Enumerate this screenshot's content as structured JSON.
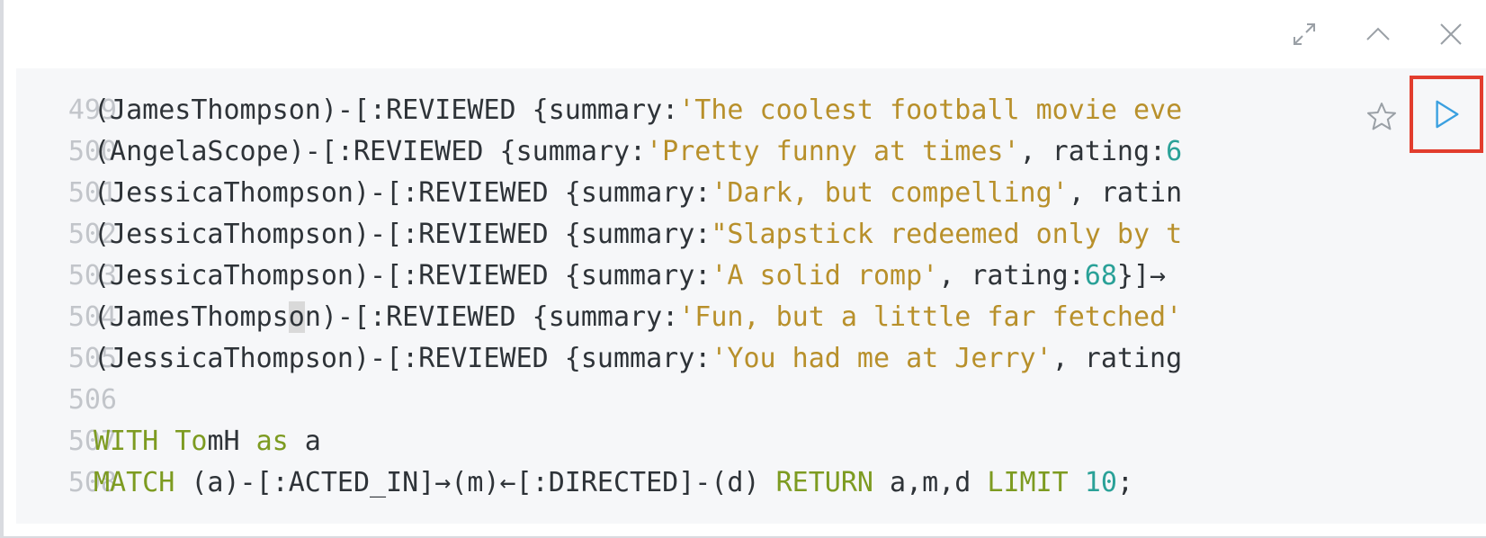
{
  "toolbar": {
    "fullscreen_icon": "expand-icon",
    "collapse_icon": "chevron-up-icon",
    "close_icon": "close-icon"
  },
  "editor": {
    "line_numbers": [
      "499",
      "500",
      "501",
      "502",
      "503",
      "504",
      "505",
      "506",
      "507",
      "508"
    ],
    "lines": [
      [
        {
          "t": "(JamesThompson)-[:REVIEWED {summary:",
          "c": ""
        },
        {
          "t": "'The coolest football movie eve",
          "c": "str"
        }
      ],
      [
        {
          "t": "(AngelaScope)-[:REVIEWED {summary:",
          "c": ""
        },
        {
          "t": "'Pretty funny at times'",
          "c": "str"
        },
        {
          "t": ", rating:",
          "c": ""
        },
        {
          "t": "6",
          "c": "num"
        }
      ],
      [
        {
          "t": "(JessicaThompson)-[:REVIEWED {summary:",
          "c": ""
        },
        {
          "t": "'Dark, but compelling'",
          "c": "str"
        },
        {
          "t": ", ratin",
          "c": ""
        }
      ],
      [
        {
          "t": "(JessicaThompson)-[:REVIEWED {summary:",
          "c": ""
        },
        {
          "t": "\"Slapstick redeemed only by t",
          "c": "str"
        }
      ],
      [
        {
          "t": "(JessicaThompson)-[:REVIEWED {summary:",
          "c": ""
        },
        {
          "t": "'A solid romp'",
          "c": "str"
        },
        {
          "t": ", rating:",
          "c": ""
        },
        {
          "t": "68",
          "c": "num"
        },
        {
          "t": "}]→",
          "c": ""
        }
      ],
      [
        {
          "t": "(JamesThomps",
          "c": ""
        },
        {
          "t": "o",
          "c": "cursor-hl"
        },
        {
          "t": "n)-[:REVIEWED {summary:",
          "c": ""
        },
        {
          "t": "'Fun, but a little far fetched'",
          "c": "str"
        }
      ],
      [
        {
          "t": "(JessicaThompson)-[:REVIEWED {summary:",
          "c": ""
        },
        {
          "t": "'You had me at Jerry'",
          "c": "str"
        },
        {
          "t": ", rating",
          "c": ""
        }
      ],
      [],
      [
        {
          "t": "WITH ",
          "c": "kw"
        },
        {
          "t": "To",
          "c": "kw"
        },
        {
          "t": "mH ",
          "c": ""
        },
        {
          "t": "as",
          "c": "kw"
        },
        {
          "t": " a",
          "c": ""
        }
      ],
      [
        {
          "t": "MATCH",
          "c": "kw"
        },
        {
          "t": " (a)-[:ACTED_IN]→(m)←[:DIRECTED]-(d) ",
          "c": ""
        },
        {
          "t": "RETURN",
          "c": "kw"
        },
        {
          "t": " a,m,d ",
          "c": ""
        },
        {
          "t": "LIMIT",
          "c": "kw"
        },
        {
          "t": " ",
          "c": ""
        },
        {
          "t": "10",
          "c": "num"
        },
        {
          "t": ";",
          "c": ""
        }
      ]
    ]
  },
  "actions": {
    "favorite_icon": "star-icon",
    "run_icon": "play-icon"
  },
  "colors": {
    "string": "#b8902b",
    "number": "#2aa198",
    "keyword": "#7d9b21",
    "highlight_border": "#e23d2e",
    "run_icon": "#3aa0e0"
  }
}
